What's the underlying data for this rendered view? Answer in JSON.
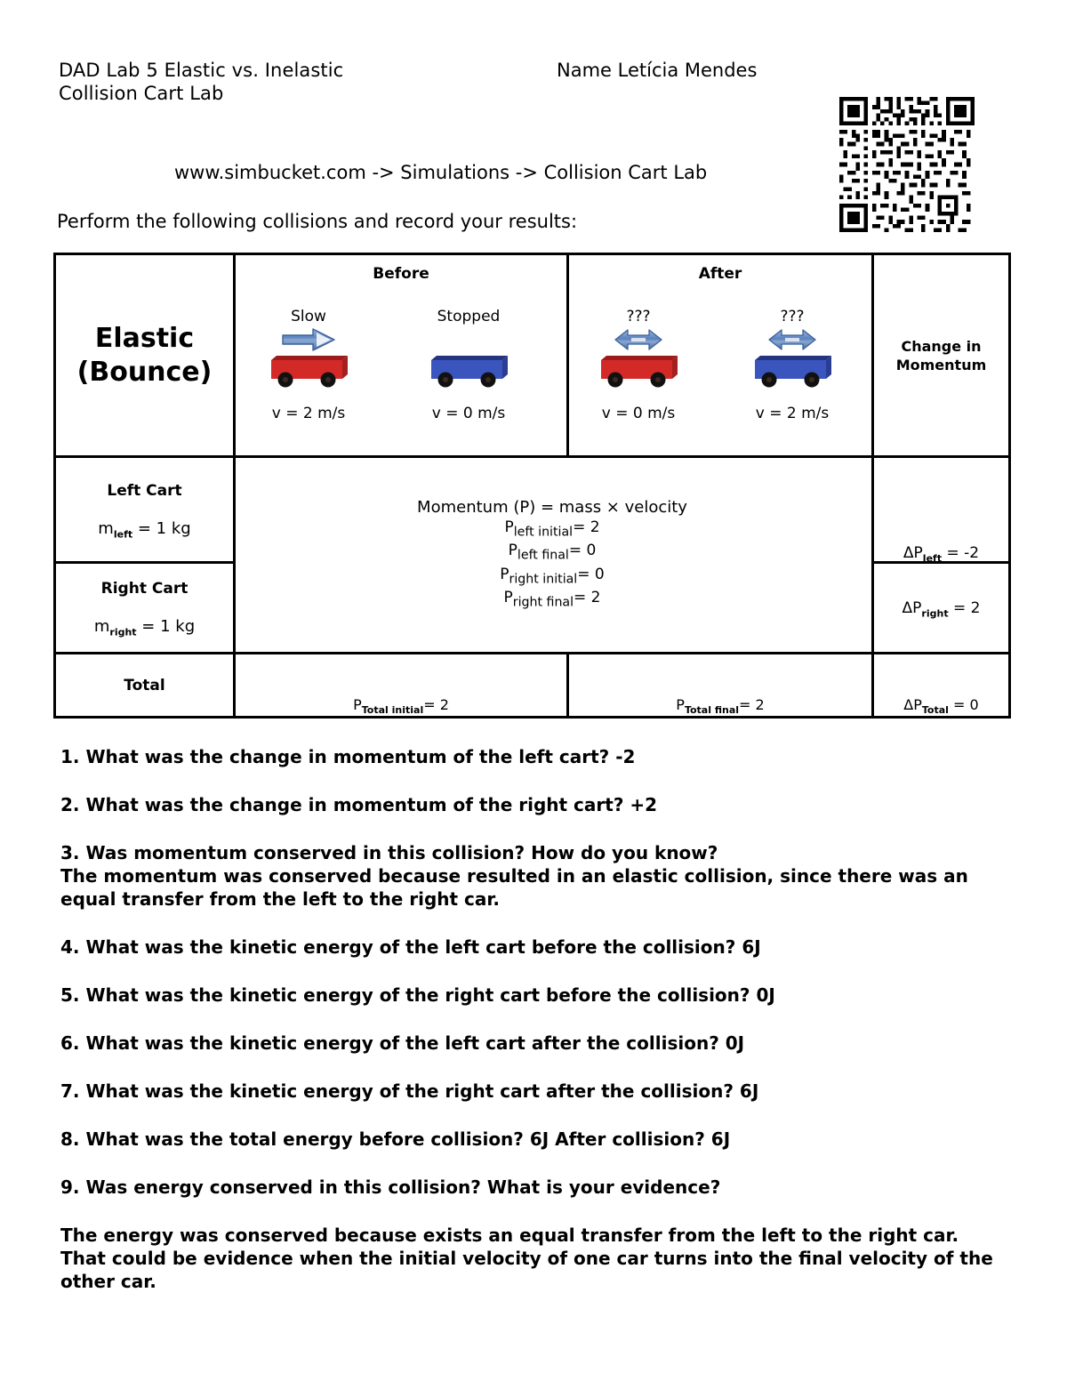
{
  "header": {
    "lab_title_line1": "DAD Lab 5 Elastic vs. Inelastic",
    "lab_title_line2": "Collision Cart Lab",
    "name_label": "Name Letícia Mendes",
    "site_path": "www.simbucket.com -> Simulations -> Collision Cart Lab",
    "instruction": "Perform the following collisions and record your results:",
    "qr_alt": "qr-code"
  },
  "table": {
    "collision_type": "Elastic\n(Bounce)",
    "collision_type_line1": "Elastic",
    "collision_type_line2": "(Bounce)",
    "before_header": "Before",
    "after_header": "After",
    "change_header_line1": "Change in",
    "change_header_line2": "Momentum",
    "carts": [
      {
        "state": "Slow",
        "arrow": "arrow-right-icon",
        "color": "#d32a28",
        "velocity": "v = 2 m/s"
      },
      {
        "state": "Stopped",
        "arrow": "none",
        "color": "#3b55bf",
        "velocity": "v = 0 m/s"
      },
      {
        "state": "???",
        "arrow": "arrow-left-right-icon",
        "color": "#d32a28",
        "velocity": "v = 0 m/s"
      },
      {
        "state": "???",
        "arrow": "arrow-left-right-icon",
        "color": "#3b55bf",
        "velocity": "v = 2 m/s"
      }
    ],
    "left_cart": {
      "label": "Left Cart",
      "mass_prefix": "m",
      "mass_sub": "left",
      "mass_value": " = 1 kg",
      "delta_prefix": "ΔP",
      "delta_sub": "left",
      "delta_value": " = -2"
    },
    "right_cart": {
      "label": "Right Cart",
      "mass_prefix": "m",
      "mass_sub": "right",
      "mass_value": " = 1 kg",
      "delta_prefix": "ΔP",
      "delta_sub": "right",
      "delta_value": " = 2"
    },
    "formula": {
      "title": "Momentum (P) = mass × velocity",
      "lines": [
        {
          "p": "P",
          "sub": "left initial",
          "val": "= 2"
        },
        {
          "p": "P",
          "sub": "left final",
          "val": "= 0"
        },
        {
          "p": "P",
          "sub": "right initial",
          "val": "= 0"
        },
        {
          "p": "P",
          "sub": "right final",
          "val": "= 2"
        }
      ]
    },
    "total_row": {
      "label": "Total",
      "before_prefix": "P",
      "before_sub": "Total initial",
      "before_value": "= 2",
      "after_prefix": "P",
      "after_sub": "Total final",
      "after_value": "= 2",
      "change_prefix": "ΔP",
      "change_sub": "Total",
      "change_value": " = 0"
    }
  },
  "questions": [
    {
      "text": "1. What was the change in momentum of the left cart? -2"
    },
    {
      "text": "2. What was the change in momentum of the right cart? +2"
    },
    {
      "text": "3. Was momentum conserved in this collision?  How do you know?"
    },
    {
      "text": "The momentum was conserved because resulted in an elastic collision, since there was an equal transfer from the left to the right car."
    },
    {
      "text": "4.  What was the kinetic energy of the left cart before the collision?   6J"
    },
    {
      "text": "5.  What was the kinetic energy of the right cart before the collision?  0J"
    },
    {
      "text": "6.  What was the kinetic energy of the left cart after the collision?   0J"
    },
    {
      "text": "7.  What was the kinetic energy of the right cart after the collision?  6J"
    },
    {
      "text": "8.  What was the total energy before collision?  6J After collision?  6J"
    },
    {
      "text": "9.  Was energy conserved in this collision?  What is your evidence?"
    },
    {
      "text": "The energy was conserved because exists an equal transfer from the left to the right car. That could be evidence when the initial velocity of one car turns into the final velocity of the other car."
    }
  ]
}
